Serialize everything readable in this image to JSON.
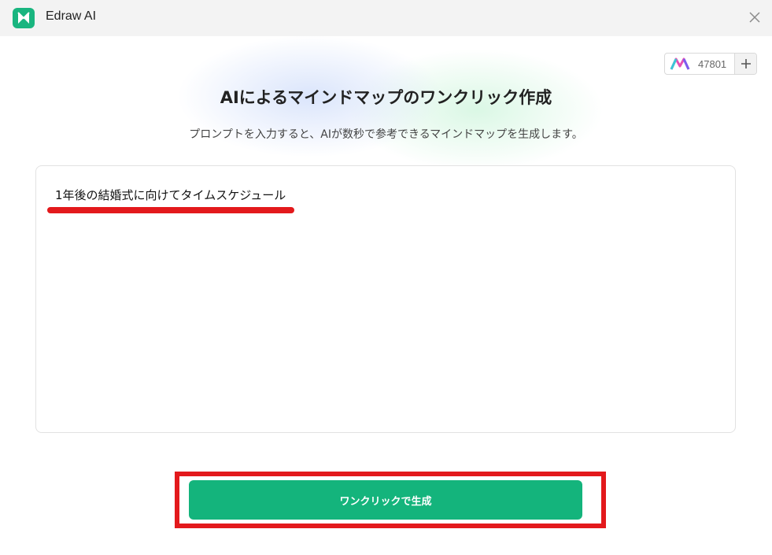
{
  "app": {
    "title": "Edraw AI",
    "logo_icon": "edraw-logo-icon",
    "accent_color": "#14b47c"
  },
  "titlebar": {
    "close_icon": "close-icon"
  },
  "credits": {
    "icon": "ai-credits-icon",
    "count": "47801",
    "add_icon": "plus-icon"
  },
  "main": {
    "title": "AIによるマインドマップのワンクリック作成",
    "subtitle": "プロンプトを入力すると、AIが数秒で参考できるマインドマップを生成します。"
  },
  "prompt": {
    "value": "1年後の結婚式に向けてタイムスケジュール"
  },
  "generate_button": {
    "label": "ワンクリックで生成"
  },
  "annotations": {
    "highlight_color": "#e3191c"
  }
}
